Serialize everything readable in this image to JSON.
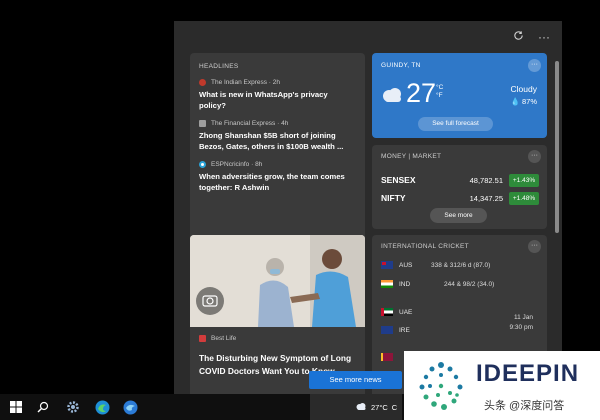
{
  "panel": {
    "refresh_icon": "refresh-icon",
    "more_icon": "more-icon"
  },
  "headlines": {
    "label": "HEADLINES",
    "items": [
      {
        "source": "The Indian Express · 2h",
        "title": "What is new in WhatsApp's privacy policy?",
        "logo_color": "#c0392b"
      },
      {
        "source": "The Financial Express · 4h",
        "title": "Zhong Shanshan $5B short of joining Bezos, Gates, others in $100B wealth ...",
        "logo_color": "#9e9e9e"
      },
      {
        "source": "ESPNcricinfo · 8h",
        "title": "When adversities grow, the team comes together: R Ashwin",
        "logo_color": "#29a3d8"
      }
    ]
  },
  "weather": {
    "location": "GUINDY, TN",
    "temp": "27",
    "unit_c": "°C",
    "unit_f": "°F",
    "condition": "Cloudy",
    "humidity": "87%",
    "button": "See full forecast",
    "bg_color": "#2f78c8"
  },
  "market": {
    "label": "MONEY | MARKET",
    "rows": [
      {
        "name": "SENSEX",
        "value": "48,782.51",
        "change": "+1.43%"
      },
      {
        "name": "NIFTY",
        "value": "14,347.25",
        "change": "+1.48%"
      }
    ],
    "button": "See more"
  },
  "health": {
    "source": "Best Life",
    "title": "The Disturbing New Symptom of Long COVID Doctors Want You to Know"
  },
  "cricket": {
    "label": "INTERNATIONAL CRICKET",
    "match1": {
      "team1": "AUS",
      "score1": "338 & 312/6 d (87.0)",
      "team2": "IND",
      "score2": "244 & 98/2 (34.0)"
    },
    "match2": {
      "team1": "UAE",
      "team2": "IRE",
      "date": "11 Jan",
      "time": "9:30 pm"
    }
  },
  "see_more_news": "See more news",
  "taskbar": {
    "weather_temp": "27°C",
    "weather_trail": "C"
  },
  "watermark": {
    "brand": "IDEEPIN",
    "sub": "头条 @深度问答"
  }
}
